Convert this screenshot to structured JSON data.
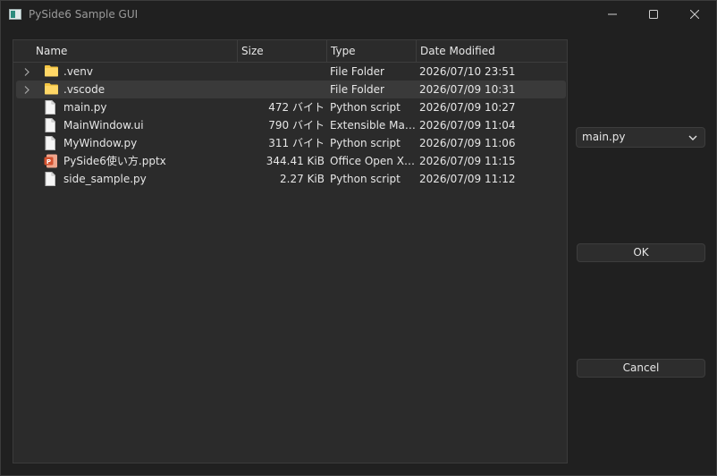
{
  "window": {
    "title": "PySide6 Sample GUI"
  },
  "file_view": {
    "columns": [
      "Name",
      "Size",
      "Type",
      "Date Modified"
    ],
    "rows": [
      {
        "name": ".venv",
        "size": "",
        "type": "File Folder",
        "date": "2026/07/10 23:51",
        "icon": "folder-icon",
        "expandable": true,
        "selected": false
      },
      {
        "name": ".vscode",
        "size": "",
        "type": "File Folder",
        "date": "2026/07/09 10:31",
        "icon": "folder-icon",
        "expandable": true,
        "selected": true
      },
      {
        "name": "main.py",
        "size": "472 バイト",
        "type": "Python script",
        "date": "2026/07/09 10:27",
        "icon": "file-icon",
        "expandable": false,
        "selected": false
      },
      {
        "name": "MainWindow.ui",
        "size": "790 バイト",
        "type": "Extensible Mark...",
        "date": "2026/07/09 11:04",
        "icon": "file-icon",
        "expandable": false,
        "selected": false
      },
      {
        "name": "MyWindow.py",
        "size": "311 バイト",
        "type": "Python script",
        "date": "2026/07/09 11:06",
        "icon": "file-icon",
        "expandable": false,
        "selected": false
      },
      {
        "name": "PySide6使い方.pptx",
        "size": "344.41 KiB",
        "type": "Office Open XM...",
        "date": "2026/07/09 11:15",
        "icon": "powerpoint-icon",
        "expandable": false,
        "selected": false
      },
      {
        "name": "side_sample.py",
        "size": "2.27 KiB",
        "type": "Python script",
        "date": "2026/07/09 11:12",
        "icon": "file-icon",
        "expandable": false,
        "selected": false
      }
    ]
  },
  "combo": {
    "value": "main.py"
  },
  "buttons": {
    "ok": "OK",
    "cancel": "Cancel"
  },
  "colors": {
    "background": "#202020",
    "panel": "#2b2b2b",
    "folder": "#f4c542",
    "powerpoint": "#d35230"
  }
}
